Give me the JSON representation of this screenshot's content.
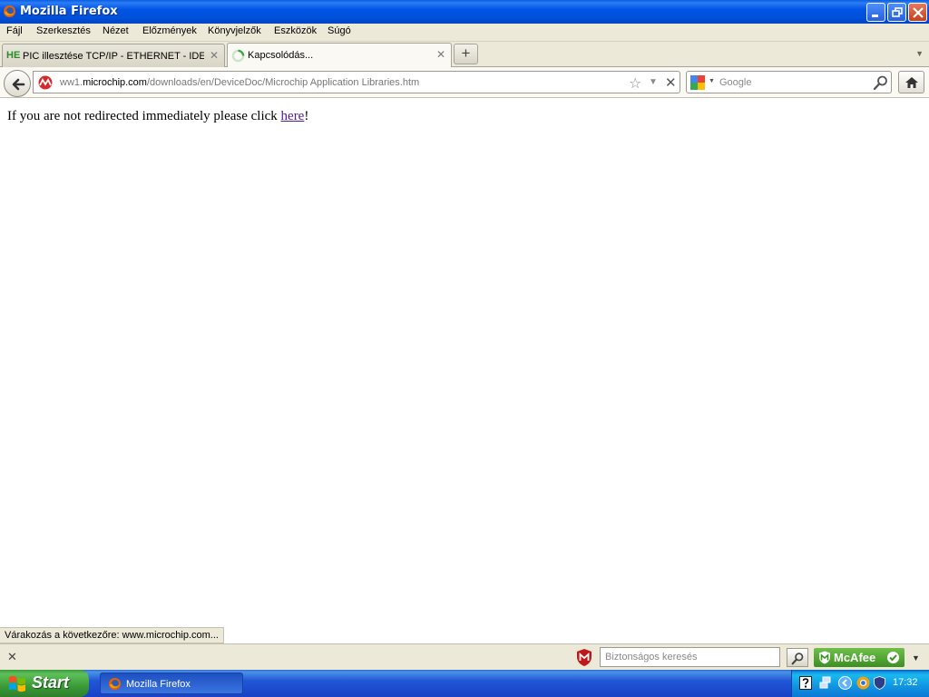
{
  "window": {
    "title": "Mozilla Firefox"
  },
  "menu": {
    "items": [
      "Fájl",
      "Szerkesztés",
      "Nézet",
      "Előzmények",
      "Könyvjelzők",
      "Eszközök",
      "Súgó"
    ]
  },
  "tabs": [
    {
      "favicon_text": "HE",
      "label": "PIC illesztése TCP/IP - ETHERNET - IDE f...",
      "active": false
    },
    {
      "favicon_text": "",
      "label": "Kapcsolódás...",
      "active": true
    }
  ],
  "new_tab_label": "+",
  "navbar": {
    "url_prefix": "ww1.",
    "url_domain": "microchip.com",
    "url_path": "/downloads/en/DeviceDoc/Microchip Application Libraries.htm",
    "search_placeholder": "Google"
  },
  "content": {
    "text_before": "If you are not redirected immediately please click ",
    "link_text": "here",
    "text_after": "!"
  },
  "status_text": "Várakozás a következőre: www.microchip.com...",
  "addon_bar": {
    "safe_search_placeholder": "Biztonságos keresés",
    "mcafee_label": "McAfee"
  },
  "taskbar": {
    "start_label": "Start",
    "task_label": "Mozilla Firefox",
    "clock": "17:32"
  },
  "colors": {
    "titlebar": "#0055e5",
    "link_visited": "#551a8b",
    "mcafee_green": "#3c8f22",
    "taskbar": "#2157d7"
  }
}
